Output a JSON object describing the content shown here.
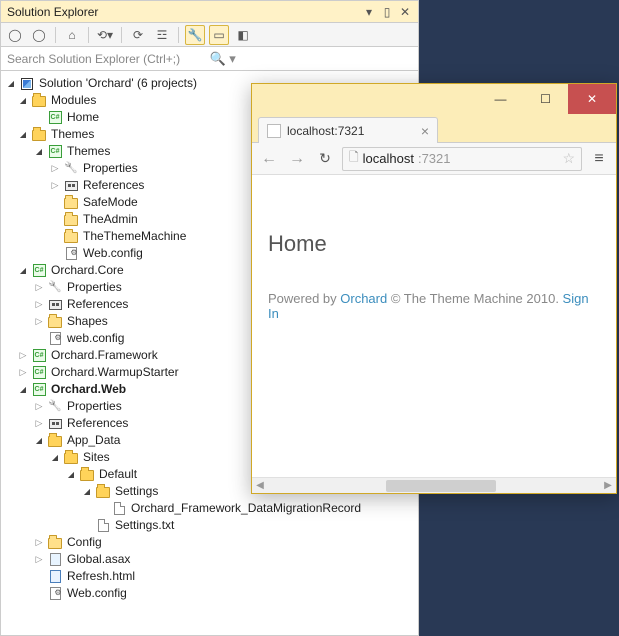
{
  "solutionExplorer": {
    "title": "Solution Explorer",
    "searchPlaceholder": "Search Solution Explorer (Ctrl+;)",
    "solution": "Solution 'Orchard' (6 projects)",
    "tree": [
      {
        "lv": 1,
        "tw": "open",
        "icon": "folder-open",
        "label": "Modules"
      },
      {
        "lv": 2,
        "tw": "none",
        "icon": "csproj",
        "label": "Home"
      },
      {
        "lv": 1,
        "tw": "open",
        "icon": "folder-open",
        "label": "Themes"
      },
      {
        "lv": 2,
        "tw": "open",
        "icon": "csproj",
        "label": "Themes"
      },
      {
        "lv": 3,
        "tw": "closed",
        "icon": "wrench",
        "label": "Properties"
      },
      {
        "lv": 3,
        "tw": "closed",
        "icon": "refs",
        "label": "References"
      },
      {
        "lv": 3,
        "tw": "none",
        "icon": "folder",
        "label": "SafeMode"
      },
      {
        "lv": 3,
        "tw": "none",
        "icon": "folder",
        "label": "TheAdmin"
      },
      {
        "lv": 3,
        "tw": "none",
        "icon": "folder",
        "label": "TheThemeMachine"
      },
      {
        "lv": 3,
        "tw": "none",
        "icon": "config",
        "label": "Web.config"
      },
      {
        "lv": 1,
        "tw": "open",
        "icon": "csproj",
        "label": "Orchard.Core"
      },
      {
        "lv": 2,
        "tw": "closed",
        "icon": "wrench",
        "label": "Properties"
      },
      {
        "lv": 2,
        "tw": "closed",
        "icon": "refs",
        "label": "References"
      },
      {
        "lv": 2,
        "tw": "closed",
        "icon": "folder",
        "label": "Shapes"
      },
      {
        "lv": 2,
        "tw": "none",
        "icon": "config",
        "label": "web.config"
      },
      {
        "lv": 1,
        "tw": "closed",
        "icon": "csproj",
        "label": "Orchard.Framework"
      },
      {
        "lv": 1,
        "tw": "closed",
        "icon": "csproj",
        "label": "Orchard.WarmupStarter"
      },
      {
        "lv": 1,
        "tw": "open",
        "icon": "csproj",
        "label": "Orchard.Web",
        "bold": true
      },
      {
        "lv": 2,
        "tw": "closed",
        "icon": "wrench",
        "label": "Properties"
      },
      {
        "lv": 2,
        "tw": "closed",
        "icon": "refs",
        "label": "References"
      },
      {
        "lv": 2,
        "tw": "open",
        "icon": "folder-open",
        "label": "App_Data"
      },
      {
        "lv": 3,
        "tw": "open",
        "icon": "folder-open",
        "label": "Sites"
      },
      {
        "lv": 4,
        "tw": "open",
        "icon": "folder-open",
        "label": "Default"
      },
      {
        "lv": 5,
        "tw": "open",
        "icon": "folder-open",
        "label": "Settings"
      },
      {
        "lv": 6,
        "tw": "none",
        "icon": "file",
        "label": "Orchard_Framework_DataMigrationRecord"
      },
      {
        "lv": 5,
        "tw": "none",
        "icon": "file",
        "label": "Settings.txt"
      },
      {
        "lv": 2,
        "tw": "closed",
        "icon": "folder",
        "label": "Config"
      },
      {
        "lv": 2,
        "tw": "closed",
        "icon": "asax",
        "label": "Global.asax"
      },
      {
        "lv": 2,
        "tw": "none",
        "icon": "html",
        "label": "Refresh.html"
      },
      {
        "lv": 2,
        "tw": "none",
        "icon": "config",
        "label": "Web.config"
      }
    ]
  },
  "browser": {
    "tabTitle": "localhost:7321",
    "urlHost": "localhost",
    "urlPort": ":7321",
    "page": {
      "heading": "Home",
      "footerPrefix": "Powered by ",
      "footerLink1": "Orchard",
      "footerMid": " © The Theme Machine 2010.   ",
      "footerLink2": "Sign In"
    }
  }
}
